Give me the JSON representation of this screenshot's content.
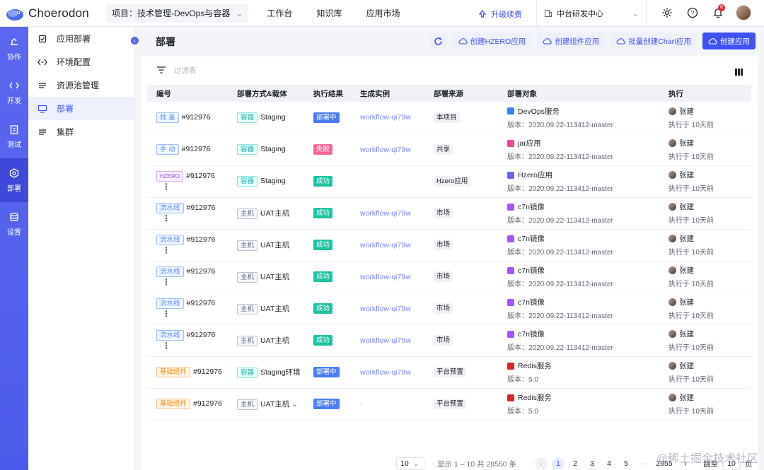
{
  "app": {
    "name": "Choerodon"
  },
  "topbar": {
    "project": "项目：技术管理-DevOps与容器",
    "nav": [
      "工作台",
      "知识库",
      "应用市场"
    ],
    "upgrade": "升级续费",
    "org": "中台研发中心",
    "bell_badge": "8"
  },
  "rail": [
    {
      "label": "协作",
      "icon": "cooperate-icon"
    },
    {
      "label": "开发",
      "icon": "code-icon"
    },
    {
      "label": "测试",
      "icon": "clipboard-icon"
    },
    {
      "label": "部署",
      "icon": "deploy-icon",
      "active": true
    },
    {
      "label": "设置",
      "icon": "database-icon"
    }
  ],
  "submenu": [
    {
      "label": "应用部署",
      "icon": "shield-check-icon"
    },
    {
      "label": "环境配置",
      "icon": "code-brackets-icon"
    },
    {
      "label": "资源池管理",
      "icon": "list-icon"
    },
    {
      "label": "部署",
      "icon": "deploy-screen-icon",
      "active": true
    },
    {
      "label": "集群",
      "icon": "list-icon"
    }
  ],
  "page": {
    "title": "部署",
    "actions": [
      "创建HZERO应用",
      "创建组件应用",
      "批量创建Chart应用",
      "创建应用"
    ],
    "filter_placeholder": "过滤表"
  },
  "table": {
    "headers": [
      "编号",
      "部署方式&载体",
      "执行结果",
      "生成实例",
      "部署来源",
      "部署对象",
      "执行"
    ],
    "rows": [
      {
        "type": "批 量",
        "type_color": "blue",
        "id": "#912976",
        "menu": false,
        "carrier_tag": "容器",
        "carrier_color": "cyan",
        "carrier": "Staging",
        "carrier_chev": false,
        "status": "部署中",
        "status_color": "blue",
        "instance": "workflow-qi79w",
        "source": "本项目",
        "target_icon": "#3b82f6",
        "target": "DevOps服务",
        "version": "版本：2020.09.22-113412-master",
        "user": "张建",
        "time": "执行于 10天前"
      },
      {
        "type": "手 动",
        "type_color": "blue",
        "id": "#912976",
        "menu": false,
        "carrier_tag": "容器",
        "carrier_color": "cyan",
        "carrier": "Staging",
        "carrier_chev": false,
        "status": "失败",
        "status_color": "red",
        "instance": "workflow-qi79w",
        "source": "共享",
        "target_icon": "#ec4899",
        "target": "jar应用",
        "version": "版本：2020.09.22-113412-master",
        "user": "张建",
        "time": "执行于 10天前"
      },
      {
        "type": "HZERO",
        "type_color": "purple",
        "id": "#912976",
        "menu": true,
        "carrier_tag": "容器",
        "carrier_color": "cyan",
        "carrier": "Staging",
        "carrier_chev": false,
        "status": "成功",
        "status_color": "green",
        "instance": "",
        "source": "Hzero应用",
        "target_icon": "#6366f1",
        "target": "Hzero应用",
        "version": "版本：2020.09.22-113412-master",
        "user": "张建",
        "time": "执行于 10天前"
      },
      {
        "type": "流水线",
        "type_color": "blue",
        "id": "#912976",
        "menu": true,
        "carrier_tag": "主机",
        "carrier_color": "gray",
        "carrier": "UAT主机",
        "carrier_chev": false,
        "status": "成功",
        "status_color": "green",
        "instance": "workflow-qi79w",
        "source": "市场",
        "target_icon": "#a855f7",
        "target": "c7n镜像",
        "version": "版本：2020.09.22-113412-master",
        "user": "张建",
        "time": "执行于 10天前"
      },
      {
        "type": "流水线",
        "type_color": "blue",
        "id": "#912976",
        "menu": true,
        "carrier_tag": "主机",
        "carrier_color": "gray",
        "carrier": "UAT主机",
        "carrier_chev": false,
        "status": "成功",
        "status_color": "green",
        "instance": "workflow-qi79w",
        "source": "市场",
        "target_icon": "#a855f7",
        "target": "c7n镜像",
        "version": "版本：2020.09.22-113412-master",
        "user": "张建",
        "time": "执行于 10天前"
      },
      {
        "type": "流水线",
        "type_color": "blue",
        "id": "#912976",
        "menu": true,
        "carrier_tag": "主机",
        "carrier_color": "gray",
        "carrier": "UAT主机",
        "carrier_chev": false,
        "status": "成功",
        "status_color": "green",
        "instance": "workflow-qi79w",
        "source": "市场",
        "target_icon": "#a855f7",
        "target": "c7n镜像",
        "version": "版本：2020.09.22-113412-master",
        "user": "张建",
        "time": "执行于 10天前"
      },
      {
        "type": "流水线",
        "type_color": "blue",
        "id": "#912976",
        "menu": true,
        "carrier_tag": "主机",
        "carrier_color": "gray",
        "carrier": "UAT主机",
        "carrier_chev": false,
        "status": "成功",
        "status_color": "green",
        "instance": "workflow-qi79w",
        "source": "市场",
        "target_icon": "#a855f7",
        "target": "c7n镜像",
        "version": "版本：2020.09.22-113412-master",
        "user": "张建",
        "time": "执行于 10天前"
      },
      {
        "type": "流水线",
        "type_color": "blue",
        "id": "#912976",
        "menu": true,
        "carrier_tag": "主机",
        "carrier_color": "gray",
        "carrier": "UAT主机",
        "carrier_chev": false,
        "status": "成功",
        "status_color": "green",
        "instance": "workflow-qi79w",
        "source": "市场",
        "target_icon": "#a855f7",
        "target": "c7n镜像",
        "version": "版本：2020.09.22-113412-master",
        "user": "张建",
        "time": "执行于 10天前"
      },
      {
        "type": "基础组件",
        "type_color": "orange",
        "id": "#912976",
        "menu": false,
        "carrier_tag": "容器",
        "carrier_color": "cyan",
        "carrier": "Staging环境",
        "carrier_chev": false,
        "status": "部署中",
        "status_color": "blue",
        "instance": "workflow-qi79w",
        "source": "平台预置",
        "target_icon": "#dc2626",
        "target": "Redis服务",
        "version": "版本：5.0",
        "user": "张建",
        "time": "执行于 10天前"
      },
      {
        "type": "基础组件",
        "type_color": "orange",
        "id": "#912976",
        "menu": false,
        "carrier_tag": "主机",
        "carrier_color": "gray",
        "carrier": "UAT主机",
        "carrier_chev": true,
        "status": "部署中",
        "status_color": "blue",
        "instance": "-",
        "source": "平台预置",
        "target_icon": "#dc2626",
        "target": "Redis服务",
        "version": "版本：5.0",
        "user": "张建",
        "time": "执行于 10天前"
      }
    ]
  },
  "pager": {
    "size": "10",
    "summary": "显示 1 – 10 共 28550 条",
    "pages": [
      "1",
      "2",
      "3",
      "4",
      "5"
    ],
    "ellipsis": "···",
    "last": "2855",
    "jump_label": "跳至",
    "jump_value": "10",
    "page_unit": "页"
  },
  "watermark": "@稀土掘金技术社区",
  "colors": {
    "accent": "#3f51f5",
    "rail": "#5b67f0"
  }
}
